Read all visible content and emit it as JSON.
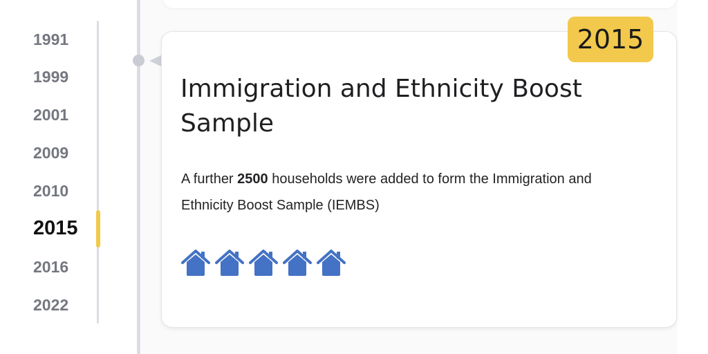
{
  "timeline": {
    "years": [
      "1991",
      "1999",
      "2001",
      "2009",
      "2010",
      "2015",
      "2016",
      "2022"
    ],
    "active_index": 5
  },
  "card": {
    "badge_year": "2015",
    "title": "Immigration and Ethnicity Boost Sample",
    "description_prefix": "A further ",
    "description_bold": "2500",
    "description_suffix": " households were added to form the Immigration and Ethnicity Boost Sample (IEMBS)",
    "house_icon": "house-icon",
    "house_count": 5,
    "house_color": "#4472c4"
  },
  "colors": {
    "accent": "#f2c94c",
    "inactive_year": "#747780",
    "active_year": "#111111"
  }
}
